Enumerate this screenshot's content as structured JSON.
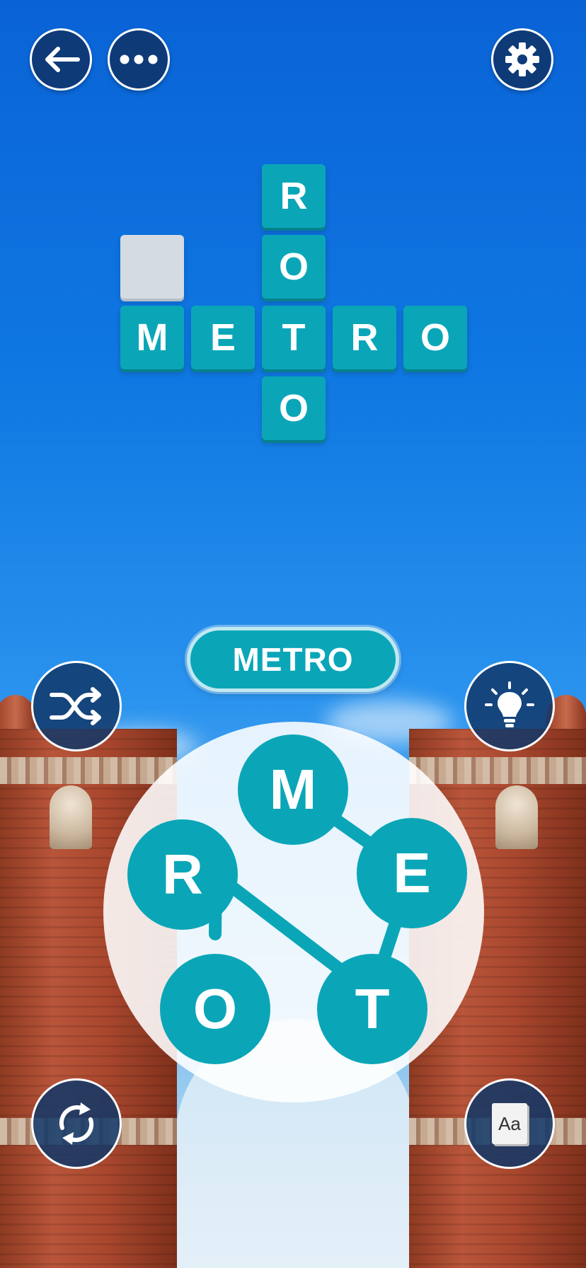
{
  "top_bar": {
    "back_icon": "arrow-left-icon",
    "more_icon": "more-dots-icon",
    "settings_icon": "gear-icon"
  },
  "grid": {
    "tiles": [
      {
        "letter": "R"
      },
      {
        "letter": "O"
      },
      {
        "letter": ""
      },
      {
        "letter": "M"
      },
      {
        "letter": "E"
      },
      {
        "letter": "T"
      },
      {
        "letter": "R"
      },
      {
        "letter": "O"
      },
      {
        "letter": "O"
      }
    ]
  },
  "current_word": "METRO",
  "side_buttons": {
    "shuffle_icon": "shuffle-icon",
    "hint_icon": "lightbulb-icon",
    "restart_icon": "refresh-icon",
    "dictionary_label": "Aa"
  },
  "wheel": {
    "letters": [
      "M",
      "E",
      "T",
      "O",
      "R"
    ]
  },
  "colors": {
    "tile": "#0aa6b8",
    "tile_empty": "#d4dbe2",
    "button_bg": "#0e3a78"
  }
}
